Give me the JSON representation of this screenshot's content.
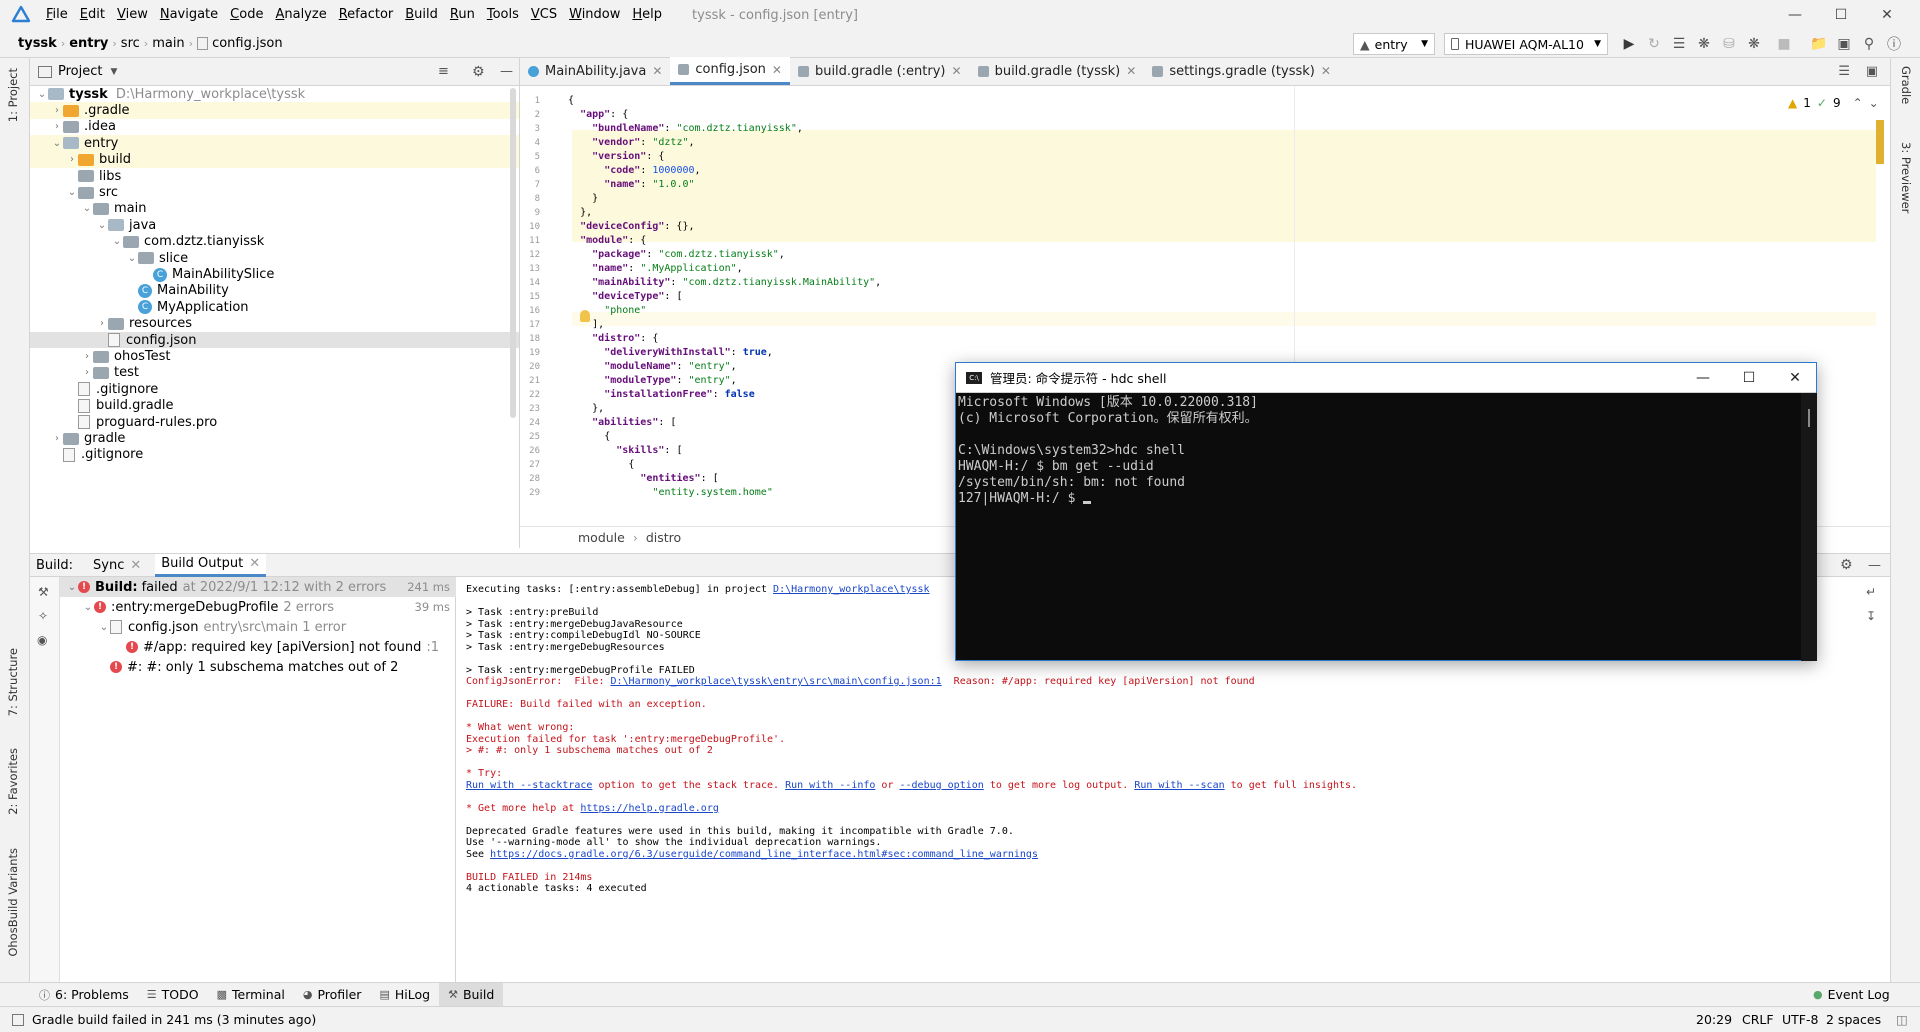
{
  "menubar": {
    "items": [
      "File",
      "Edit",
      "View",
      "Navigate",
      "Code",
      "Analyze",
      "Refactor",
      "Build",
      "Run",
      "Tools",
      "VCS",
      "Window",
      "Help"
    ],
    "window_title": "tyssk - config.json [entry]"
  },
  "navbar": {
    "breadcrumbs": [
      "tyssk",
      "entry",
      "src",
      "main",
      "config.json"
    ],
    "run_config": "entry",
    "device": "HUAWEI AQM-AL10"
  },
  "left_strip": {
    "tabs": [
      "1: Project",
      "7: Structure",
      "2: Favorites",
      "OhosBuild Variants"
    ]
  },
  "right_strip": {
    "tabs": [
      "Gradle",
      "3: Previewer"
    ]
  },
  "project": {
    "header": "Project",
    "tree": [
      {
        "name": "tyssk",
        "path": "D:\\Harmony_workplace\\tyssk",
        "icon": "folder-blue",
        "level": 0,
        "expanded": true
      },
      {
        "name": ".gradle",
        "icon": "folder-orange",
        "level": 1,
        "expanded": false
      },
      {
        "name": ".idea",
        "icon": "folder-gray",
        "level": 1,
        "expanded": false
      },
      {
        "name": "entry",
        "icon": "folder-blue",
        "level": 1,
        "expanded": true
      },
      {
        "name": "build",
        "icon": "folder-orange",
        "level": 2,
        "expanded": false
      },
      {
        "name": "libs",
        "icon": "folder-gray",
        "level": 2
      },
      {
        "name": "src",
        "icon": "folder-gray",
        "level": 2,
        "expanded": true
      },
      {
        "name": "main",
        "icon": "folder-gray",
        "level": 3,
        "expanded": true
      },
      {
        "name": "java",
        "icon": "folder-blue",
        "level": 4,
        "expanded": true
      },
      {
        "name": "com.dztz.tianyissk",
        "icon": "package",
        "level": 5,
        "expanded": true
      },
      {
        "name": "slice",
        "icon": "package",
        "level": 6,
        "expanded": true
      },
      {
        "name": "MainAbilitySlice",
        "icon": "class",
        "level": 7
      },
      {
        "name": "MainAbility",
        "icon": "class",
        "level": 6
      },
      {
        "name": "MyApplication",
        "icon": "class",
        "level": 6
      },
      {
        "name": "resources",
        "icon": "folder-gray",
        "level": 4,
        "expanded": false
      },
      {
        "name": "config.json",
        "icon": "file",
        "level": 4,
        "selected": true
      },
      {
        "name": "ohosTest",
        "icon": "folder-gray",
        "level": 3,
        "expanded": false
      },
      {
        "name": "test",
        "icon": "folder-gray",
        "level": 3,
        "expanded": false
      },
      {
        "name": ".gitignore",
        "icon": "file",
        "level": 2
      },
      {
        "name": "build.gradle",
        "icon": "file",
        "level": 2
      },
      {
        "name": "proguard-rules.pro",
        "icon": "file",
        "level": 2
      },
      {
        "name": "gradle",
        "icon": "folder-gray",
        "level": 1,
        "expanded": false
      },
      {
        "name": ".gitignore",
        "icon": "file",
        "level": 1
      }
    ]
  },
  "editor": {
    "tabs": [
      {
        "label": "MainAbility.java",
        "active": false
      },
      {
        "label": "config.json",
        "active": true
      },
      {
        "label": "build.gradle (:entry)",
        "active": false
      },
      {
        "label": "build.gradle (tyssk)",
        "active": false
      },
      {
        "label": "settings.gradle (tyssk)",
        "active": false
      }
    ],
    "inspection": {
      "warnings": "1",
      "weak_warnings": "9"
    },
    "code_lines": [
      "{",
      "  \"app\": {",
      "    \"bundleName\": \"com.dztz.tianyissk\",",
      "    \"vendor\": \"dztz\",",
      "    \"version\": {",
      "      \"code\": 1000000,",
      "      \"name\": \"1.0.0\"",
      "    }",
      "  },",
      "  \"deviceConfig\": {},",
      "  \"module\": {",
      "    \"package\": \"com.dztz.tianyissk\",",
      "    \"name\": \".MyApplication\",",
      "    \"mainAbility\": \"com.dztz.tianyissk.MainAbility\",",
      "    \"deviceType\": [",
      "      \"phone\"",
      "    ],",
      "    \"distro\": {",
      "      \"deliveryWithInstall\": true,",
      "      \"moduleName\": \"entry\",",
      "      \"moduleType\": \"entry\",",
      "      \"installationFree\": false",
      "    },",
      "    \"abilities\": [",
      "      {",
      "        \"skills\": [",
      "          {",
      "            \"entities\": [",
      "              \"entity.system.home\""
    ],
    "breadcrumb": [
      "module",
      "distro"
    ]
  },
  "build": {
    "header_label": "Build:",
    "tabs": [
      "Sync",
      "Build Output"
    ],
    "tree": [
      {
        "label": "Build:",
        "status": "failed",
        "detail": "at 2022/9/1 12:12 with 2 errors",
        "time": "241 ms"
      },
      {
        "label": ":entry:mergeDebugProfile",
        "detail": "2 errors",
        "time": "39 ms"
      },
      {
        "label": "config.json",
        "detail": "entry\\src\\main 1 error"
      },
      {
        "label": "#/app: required key [apiVersion] not found",
        "detail": ":1"
      },
      {
        "label": "#: #: only 1 subschema matches out of 2"
      }
    ],
    "output": [
      {
        "text": "Executing tasks: [:entry:assembleDebug] in project ",
        "link": "D:\\Harmony_workplace\\tyssk",
        "style": "normal"
      },
      {
        "text": "",
        "style": "normal"
      },
      {
        "text": "> Task :entry:preBuild",
        "style": "normal"
      },
      {
        "text": "> Task :entry:mergeDebugJavaResource",
        "style": "normal"
      },
      {
        "text": "> Task :entry:compileDebugIdl NO-SOURCE",
        "style": "normal"
      },
      {
        "text": "> Task :entry:mergeDebugResources",
        "style": "normal"
      },
      {
        "text": "",
        "style": "normal"
      },
      {
        "text": "> Task :entry:mergeDebugProfile FAILED",
        "style": "normal"
      },
      {
        "text": "ConfigJsonError:  File: ",
        "link": "D:\\Harmony_workplace\\tyssk\\entry\\src\\main\\config.json:1",
        "after": "  Reason: #/app: required key [apiVersion] not found",
        "style": "red"
      },
      {
        "text": "",
        "style": "normal"
      },
      {
        "text": "FAILURE: Build failed with an exception.",
        "style": "red"
      },
      {
        "text": "",
        "style": "normal"
      },
      {
        "text": "* What went wrong:",
        "style": "red"
      },
      {
        "text": "Execution failed for task ':entry:mergeDebugProfile'.",
        "style": "red"
      },
      {
        "text": "> #: #: only 1 subschema matches out of 2",
        "style": "red"
      },
      {
        "text": "",
        "style": "normal"
      },
      {
        "text": "* Try:",
        "style": "red"
      },
      {
        "segments": [
          {
            "t": "Run with --stacktrace",
            "link": true
          },
          {
            "t": " option to get the stack trace. ",
            "link": false
          },
          {
            "t": "Run with --info",
            "link": true
          },
          {
            "t": " or ",
            "link": false
          },
          {
            "t": "--debug option",
            "link": true
          },
          {
            "t": " to get more log output. ",
            "link": false
          },
          {
            "t": "Run with --scan",
            "link": true
          },
          {
            "t": " to get full insights.",
            "link": false
          }
        ],
        "style": "red"
      },
      {
        "text": "",
        "style": "normal"
      },
      {
        "text": "* Get more help at ",
        "link": "https://help.gradle.org",
        "style": "red"
      },
      {
        "text": "",
        "style": "normal"
      },
      {
        "text": "Deprecated Gradle features were used in this build, making it incompatible with Gradle 7.0.",
        "style": "normal"
      },
      {
        "text": "Use '--warning-mode all' to show the individual deprecation warnings.",
        "style": "normal"
      },
      {
        "text": "See ",
        "link": "https://docs.gradle.org/6.3/userguide/command_line_interface.html#sec:command_line_warnings",
        "style": "normal"
      },
      {
        "text": "",
        "style": "normal"
      },
      {
        "text": "BUILD FAILED in 214ms",
        "style": "red"
      },
      {
        "text": "4 actionable tasks: 4 executed",
        "style": "normal"
      }
    ]
  },
  "bottom_tabs": [
    "6: Problems",
    "TODO",
    "Terminal",
    "Profiler",
    "HiLog",
    "Build"
  ],
  "event_log": "Event Log",
  "status": {
    "message": "Gradle build failed in 241 ms (3 minutes ago)",
    "position": "20:29",
    "line_sep": "CRLF",
    "encoding": "UTF-8",
    "indent": "2 spaces"
  },
  "terminal": {
    "title": "管理员: 命令提示符 - hdc  shell",
    "lines": [
      "Microsoft Windows [版本 10.0.22000.318]",
      "(c) Microsoft Corporation。保留所有权利。",
      "",
      "C:\\Windows\\system32>hdc shell",
      "HWAQM-H:/ $ bm get --udid",
      "/system/bin/sh: bm: not found",
      "127|HWAQM-H:/ $ "
    ]
  },
  "colors": {
    "accent": "#4a88c7",
    "error": "#e5484d",
    "error_text": "#c4141b",
    "link": "#1a46c8",
    "highlight": "#fdf9dc"
  }
}
